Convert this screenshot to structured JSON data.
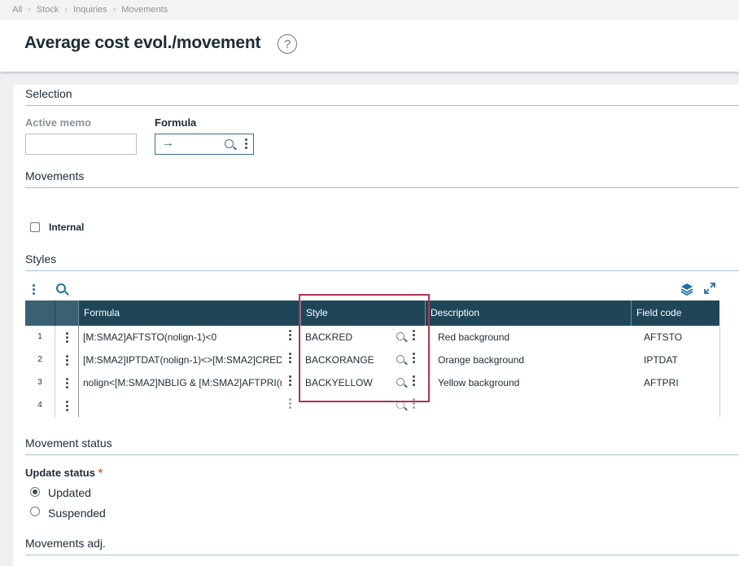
{
  "breadcrumb": [
    "All",
    "Stock",
    "Inquiries",
    "Movements"
  ],
  "page": {
    "title": "Average cost evol./movement",
    "help_symbol": "?"
  },
  "selection": {
    "title": "Selection",
    "active_memo_label": "Active memo",
    "active_memo_value": "",
    "formula_label": "Formula",
    "formula_arrow": "→"
  },
  "movements": {
    "title": "Movements",
    "internal_label": "Internal",
    "internal_checked": false
  },
  "styles": {
    "title": "Styles",
    "columns": [
      "Formula",
      "Style",
      "Description",
      "Field code"
    ],
    "rows": [
      {
        "num": "1",
        "formula": "[M:SMA2]AFTSTO(nolign-1)<0",
        "style": "BACKRED",
        "description": "Red background",
        "field_code": "AFTSTO"
      },
      {
        "num": "2",
        "formula": "[M:SMA2]IPTDAT(nolign-1)<>[M:SMA2]CRED.",
        "style": "BACKORANGE",
        "description": "Orange background",
        "field_code": "IPTDAT"
      },
      {
        "num": "3",
        "formula": "nolign<[M:SMA2]NBLIG & [M:SMA2]AFTPRI(r",
        "style": "BACKYELLOW",
        "description": "Yellow background",
        "field_code": "AFTPRI"
      },
      {
        "num": "4",
        "formula": "",
        "style": "",
        "description": "",
        "field_code": ""
      }
    ]
  },
  "movement_status": {
    "title": "Movement status",
    "update_status_label": "Update status",
    "required_mark": "*",
    "options": [
      {
        "label": "Updated",
        "selected": true
      },
      {
        "label": "Suspended",
        "selected": false
      }
    ]
  },
  "movements_adj": {
    "title": "Movements adj."
  },
  "colors": {
    "header": "#1f4559",
    "accent": "#1f6fa3",
    "highlight": "#b4344d",
    "required": "#e0632c"
  }
}
